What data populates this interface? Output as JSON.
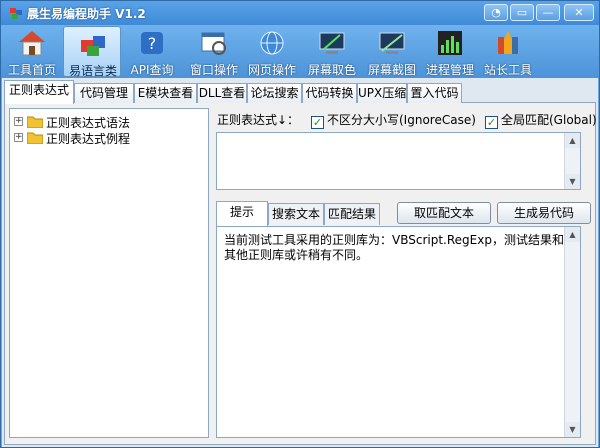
{
  "app": {
    "title": "晨生易编程助手 V1.2"
  },
  "window_buttons": {
    "skin": "◔",
    "menu": "▭",
    "minimize": "—",
    "close": "✕"
  },
  "toolbar": [
    {
      "label": "工具首页",
      "icon": "home-icon",
      "active": false
    },
    {
      "label": "易语言类",
      "icon": "blocks-icon",
      "active": true
    },
    {
      "label": "API查询",
      "icon": "api-help-icon",
      "active": false
    },
    {
      "label": "窗口操作",
      "icon": "window-icon",
      "active": false
    },
    {
      "label": "网页操作",
      "icon": "globe-icon",
      "active": false
    },
    {
      "label": "屏幕取色",
      "icon": "color-picker-icon",
      "active": false
    },
    {
      "label": "屏幕截图",
      "icon": "screenshot-icon",
      "active": false
    },
    {
      "label": "进程管理",
      "icon": "process-icon",
      "active": false
    },
    {
      "label": "站长工具",
      "icon": "webmaster-icon",
      "active": false
    }
  ],
  "tabs": [
    {
      "label": "正则表达式",
      "active": true
    },
    {
      "label": "代码管理",
      "active": false
    },
    {
      "label": "E模块查看",
      "active": false
    },
    {
      "label": "DLL查看",
      "active": false
    },
    {
      "label": "论坛搜索",
      "active": false
    },
    {
      "label": "代码转换",
      "active": false
    },
    {
      "label": "UPX压缩",
      "active": false
    },
    {
      "label": "置入代码",
      "active": false
    }
  ],
  "tree": {
    "items": [
      {
        "label": "正则表达式语法",
        "expander": "+"
      },
      {
        "label": "正则表达式例程",
        "expander": "+"
      }
    ]
  },
  "regex": {
    "label": "正则表达式↓：",
    "value": "",
    "ignore_case": {
      "label": "不区分大小写(IgnoreCase)",
      "checked": true,
      "mark": "✓"
    },
    "global": {
      "label": "全局匹配(Global)",
      "checked": true,
      "mark": "✓"
    }
  },
  "subtabs": [
    {
      "label": "提示",
      "active": true
    },
    {
      "label": "搜索文本",
      "active": false
    },
    {
      "label": "匹配结果",
      "active": false
    }
  ],
  "actions": {
    "match_text": "取匹配文本",
    "generate_code": "生成易代码"
  },
  "output": {
    "text": "当前测试工具采用的正则库为：VBScript.RegExp，测试结果和其他正则库或许稍有不同。"
  },
  "scrollbar": {
    "up": "▲",
    "down": "▼"
  }
}
